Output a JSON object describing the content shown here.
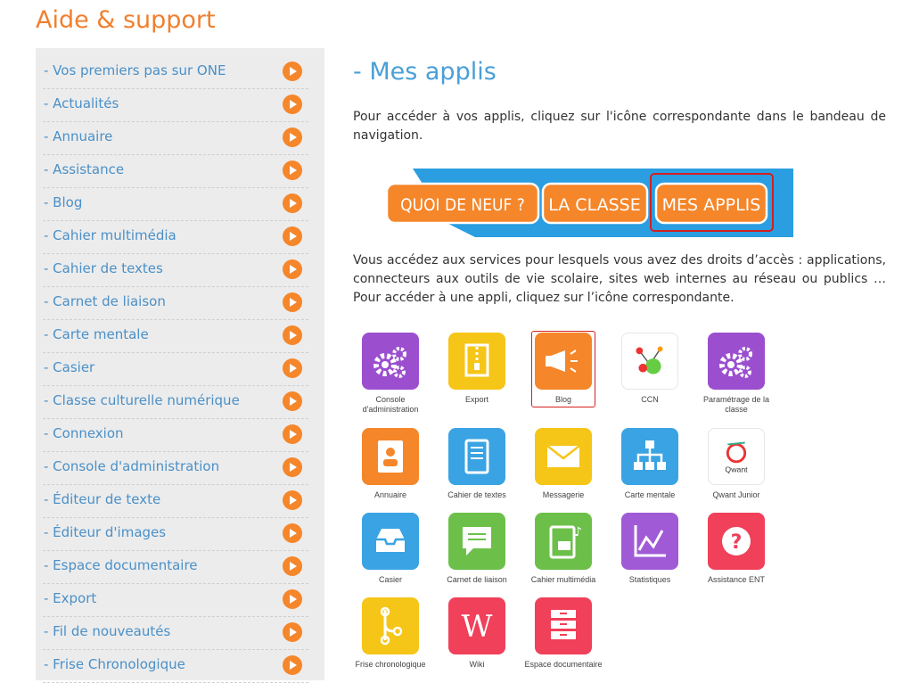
{
  "page": {
    "title": "Aide & support"
  },
  "sidebar": {
    "items": [
      {
        "label": "- Vos premiers pas sur ONE"
      },
      {
        "label": "- Actualités"
      },
      {
        "label": "- Annuaire"
      },
      {
        "label": "- Assistance"
      },
      {
        "label": "- Blog"
      },
      {
        "label": "- Cahier multimédia"
      },
      {
        "label": "- Cahier de textes"
      },
      {
        "label": "- Carnet de liaison"
      },
      {
        "label": "- Carte mentale"
      },
      {
        "label": "- Casier"
      },
      {
        "label": "- Classe culturelle numérique"
      },
      {
        "label": "- Connexion"
      },
      {
        "label": "- Console d'administration"
      },
      {
        "label": "- Éditeur de texte"
      },
      {
        "label": "- Éditeur d'images"
      },
      {
        "label": "- Espace documentaire"
      },
      {
        "label": "- Export"
      },
      {
        "label": "- Fil de nouveautés"
      },
      {
        "label": "- Frise Chronologique"
      }
    ]
  },
  "main": {
    "section_title": "- Mes applis",
    "intro": "Pour accéder à vos applis, cliquez sur l'icône correspondante dans le bandeau de navigation.",
    "banner": {
      "buttons": [
        "QUOI DE NEUF ?",
        "LA CLASSE",
        "MES APPLIS"
      ],
      "colors": {
        "blue": "#2a9ee0",
        "orange": "#f5862a",
        "highlight": "#d32020"
      }
    },
    "description": "Vous accédez aux services pour lesquels vous avez des droits d’accès : applications, connecteurs aux outils de vie scolaire, sites web internes au réseau ou publics … Pour accéder à une appli, cliquez sur l’icône correspondante.",
    "apps": [
      {
        "label": "Console d'administration",
        "color": "#9b4fcf",
        "icon": "gears-icon"
      },
      {
        "label": "Export",
        "color": "#f5c518",
        "icon": "zip-file-icon"
      },
      {
        "label": "Blog",
        "color": "#f5862a",
        "icon": "megaphone-icon",
        "highlighted": true
      },
      {
        "label": "CCN",
        "color": "#ffffff",
        "icon": "ccn-logo-icon"
      },
      {
        "label": "Paramétrage de la classe",
        "color": "#9b4fcf",
        "icon": "gears-icon"
      },
      {
        "label": "Annuaire",
        "color": "#f5862a",
        "icon": "address-book-icon"
      },
      {
        "label": "Cahier de textes",
        "color": "#3aa3e3",
        "icon": "notebook-icon"
      },
      {
        "label": "Messagerie",
        "color": "#f5c518",
        "icon": "envelope-icon"
      },
      {
        "label": "Carte mentale",
        "color": "#3aa3e3",
        "icon": "sitemap-icon"
      },
      {
        "label": "Qwant Junior",
        "color": "#ffffff",
        "icon": "qwant-logo-icon"
      },
      {
        "label": "Casier",
        "color": "#3aa3e3",
        "icon": "inbox-tray-icon"
      },
      {
        "label": "Carnet de liaison",
        "color": "#6cc04a",
        "icon": "chat-bubble-icon"
      },
      {
        "label": "Cahier multimédia",
        "color": "#6cc04a",
        "icon": "multimedia-notebook-icon"
      },
      {
        "label": "Statistiques",
        "color": "#a05ad6",
        "icon": "line-chart-icon"
      },
      {
        "label": "Assistance ENT",
        "color": "#f0405a",
        "icon": "question-mark-icon"
      },
      {
        "label": "Frise chronologique",
        "color": "#f5c518",
        "icon": "timeline-icon"
      },
      {
        "label": "Wiki",
        "color": "#f0405a",
        "icon": "wiki-w-icon"
      },
      {
        "label": "Espace documentaire",
        "color": "#f0405a",
        "icon": "file-drawer-icon"
      }
    ]
  }
}
